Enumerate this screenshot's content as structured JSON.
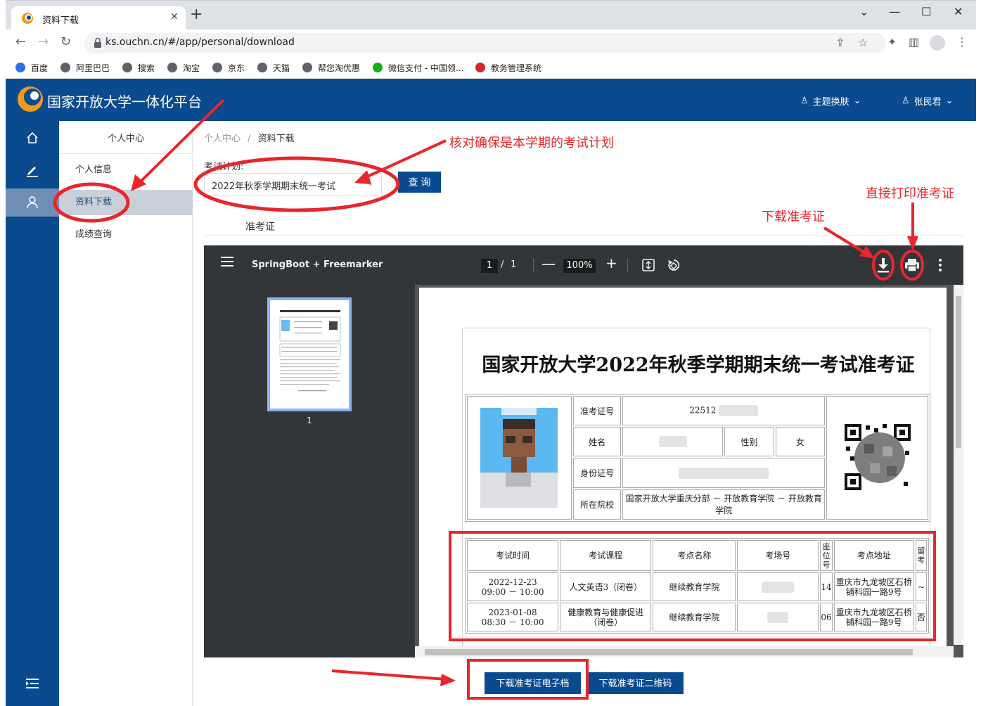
{
  "browser": {
    "tab_title": "资料下载",
    "url": "ks.ouchn.cn/#/app/personal/download",
    "window_controls": [
      "chevron-down-icon",
      "minimize-icon",
      "maximize-icon",
      "close-icon"
    ],
    "bookmarks": [
      {
        "label": "百度",
        "color": "#2f6fe4"
      },
      {
        "label": "阿里巴巴",
        "color": "#5f6368"
      },
      {
        "label": "搜索",
        "color": "#5f6368"
      },
      {
        "label": "淘宝",
        "color": "#5f6368"
      },
      {
        "label": "京东",
        "color": "#5f6368"
      },
      {
        "label": "天猫",
        "color": "#5f6368"
      },
      {
        "label": "帮您淘优惠",
        "color": "#5f6368"
      },
      {
        "label": "微信支付 - 中国领...",
        "color": "#1aad19"
      },
      {
        "label": "教务管理系统",
        "color": "#d6262c"
      }
    ]
  },
  "app": {
    "title": "国家开放大学一体化平台",
    "theme_label": "主题换肤",
    "user_name": "张民君",
    "accent": "#0a4a8f"
  },
  "rail": {
    "items": [
      "home-icon",
      "edit-icon",
      "user-icon"
    ],
    "footer": "collapse-menu-icon"
  },
  "submenu": {
    "title": "个人中心",
    "items": [
      "个人信息",
      "资料下载",
      "成绩查询"
    ]
  },
  "content": {
    "breadcrumb": {
      "root": "个人中心",
      "sep": "/",
      "current": "资料下载"
    },
    "plan_label": "考试计划:",
    "plan_value": "2022年秋季学期期末统一考试",
    "query_button": "查 询",
    "section_title": "准考证"
  },
  "pdf": {
    "doc_title": "SpringBoot + Freemarker",
    "page_current": "1",
    "page_sep": "/",
    "page_total": "1",
    "zoom": "100%",
    "thumb_label": "1"
  },
  "ticket": {
    "title": "国家开放大学2022年秋季学期期末统一考试准考证",
    "labels": {
      "ticket_no": "准考证号",
      "name": "姓名",
      "gender": "性别",
      "id_no": "身份证号",
      "school": "所在院校"
    },
    "values": {
      "ticket_no_prefix": "22512",
      "gender": "女",
      "school": "国家开放大学重庆分部 － 开放教育学院 － 开放教育学院"
    },
    "exam_headers": [
      "考试时间",
      "考试课程",
      "考点名称",
      "考场号",
      "座位号",
      "考点地址",
      "留考"
    ],
    "exam_rows": [
      {
        "time": "2022-12-23\n09:00 － 10:00",
        "course": "人文英语3（闭卷）",
        "site": "继续教育学院",
        "seat": "14",
        "address": "重庆市九龙坡区石桥铺科园一路9号",
        "retake": "~"
      },
      {
        "time": "2023-01-08\n08:30 － 10:00",
        "course": "健康教育与健康促进（闭卷）",
        "site": "继续教育学院",
        "seat": "06",
        "address": "重庆市九龙坡区石桥铺科园一路9号",
        "retake": "否"
      }
    ]
  },
  "footer_buttons": {
    "download_e": "下载准考证电子档",
    "download_qr": "下载准考证二维码"
  },
  "annotations": {
    "check_plan": "核对确保是本学期的考试计划",
    "print_direct": "直接打印准考证",
    "download_ticket": "下载准考证",
    "color": "#e8262c"
  }
}
